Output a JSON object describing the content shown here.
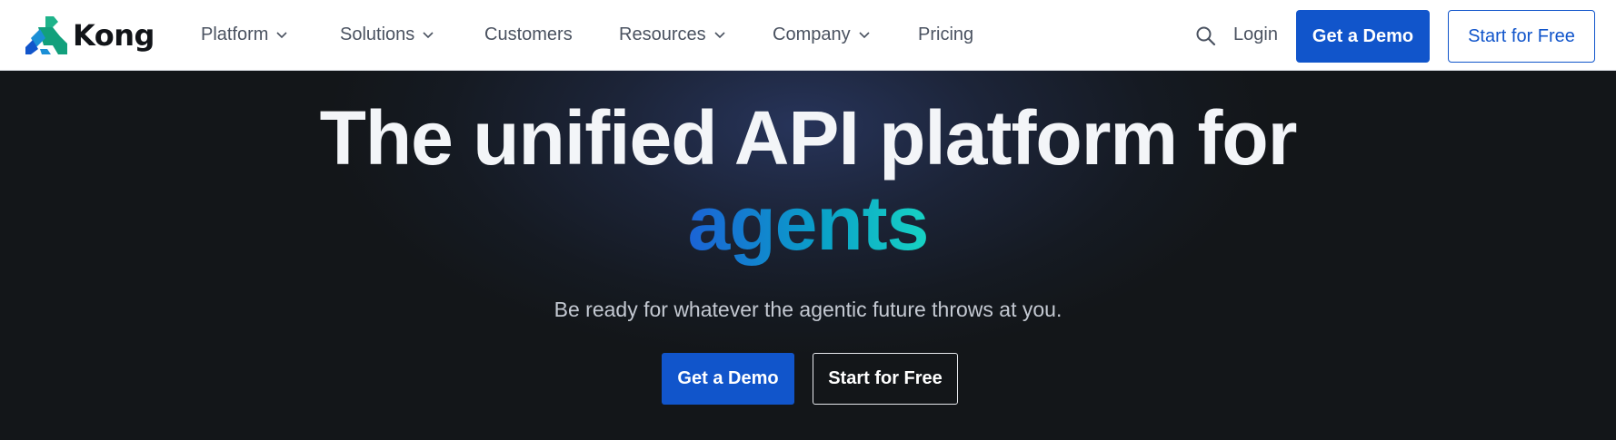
{
  "brand": {
    "name": "Kong",
    "icon": "kong-gorilla-logo",
    "colors": [
      "#1155cb",
      "#12a07c",
      "#17d3c4"
    ]
  },
  "nav": {
    "items": [
      {
        "label": "Platform",
        "dropdown": true
      },
      {
        "label": "Solutions",
        "dropdown": true
      },
      {
        "label": "Customers",
        "dropdown": false
      },
      {
        "label": "Resources",
        "dropdown": true
      },
      {
        "label": "Company",
        "dropdown": true
      },
      {
        "label": "Pricing",
        "dropdown": false
      }
    ],
    "search_icon": "search-icon",
    "login_label": "Login",
    "demo_label": "Get a Demo",
    "free_label": "Start for Free"
  },
  "hero": {
    "headline": "The unified API platform for",
    "highlight": "agents",
    "subtitle": "Be ready for whatever the agentic future throws at you.",
    "demo_label": "Get a Demo",
    "free_label": "Start for Free"
  },
  "colors": {
    "accent": "#1155cb",
    "hero_bg": "#131619",
    "gradient_start": "#1b63d6",
    "gradient_end": "#17d3c4"
  }
}
